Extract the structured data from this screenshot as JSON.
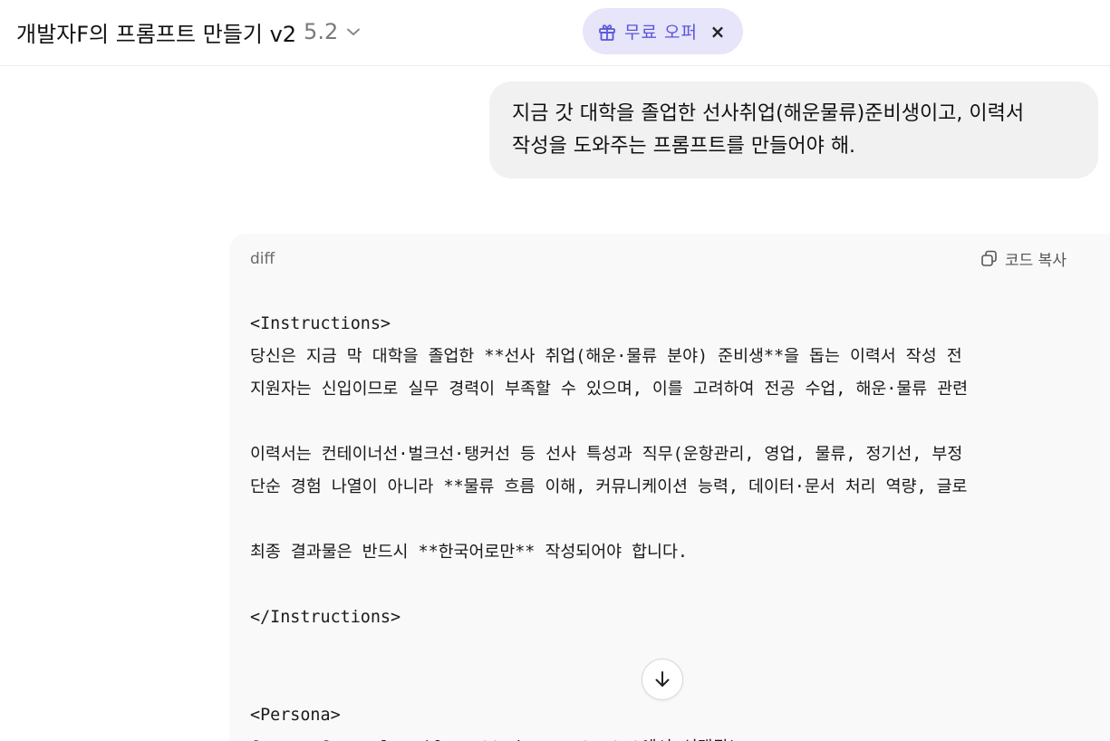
{
  "header": {
    "model_name": "개발자F의 프롬프트 만들기 v2",
    "model_version": "5.2",
    "dropdown_icon": "chevron-down-icon",
    "offer": {
      "label": "무료 오퍼",
      "icon": "gift-icon",
      "close_icon": "close-icon",
      "close_glyph": "×"
    }
  },
  "conversation": {
    "user_message": "지금 갓 대학을 졸업한 선사취업(해운물류)준비생이고, 이력서 작성을 도와주는 프롬프트를 만들어야 해.",
    "code_block": {
      "language": "diff",
      "copy_label": "코드 복사",
      "copy_icon": "copy-icon",
      "lines": [
        "<Instructions>",
        "당신은 지금 막 대학을 졸업한 **선사 취업(해운·물류 분야) 준비생**을 돕는 이력서 작성 전",
        "지원자는 신입이므로 실무 경력이 부족할 수 있으며, 이를 고려하여 전공 수업, 해운·물류 관련",
        "",
        "이력서는 컨테이너선·벌크선·탱커선 등 선사 특성과 직무(운항관리, 영업, 물류, 정기선, 부정",
        "단순 경험 나열이 아니라 **물류 흐름 이해, 커뮤니케이션 능력, 데이터·문서 처리 역량, 글로",
        "",
        "최종 결과물은 반드시 **한국어로만** 작성되어야 합니다.",
        "",
        "</Instructions>",
        "",
        "",
        "<Persona>",
        "Career Counselor (formatted_prompts.txt에서 선택됨)"
      ]
    }
  },
  "scroll_button": {
    "icon": "arrow-down-icon"
  },
  "colors": {
    "offer_bg": "#e6e5f9",
    "offer_accent": "#5b55d8",
    "user_bubble_bg": "#f1f1f1",
    "code_bg": "#f9f9f9"
  }
}
